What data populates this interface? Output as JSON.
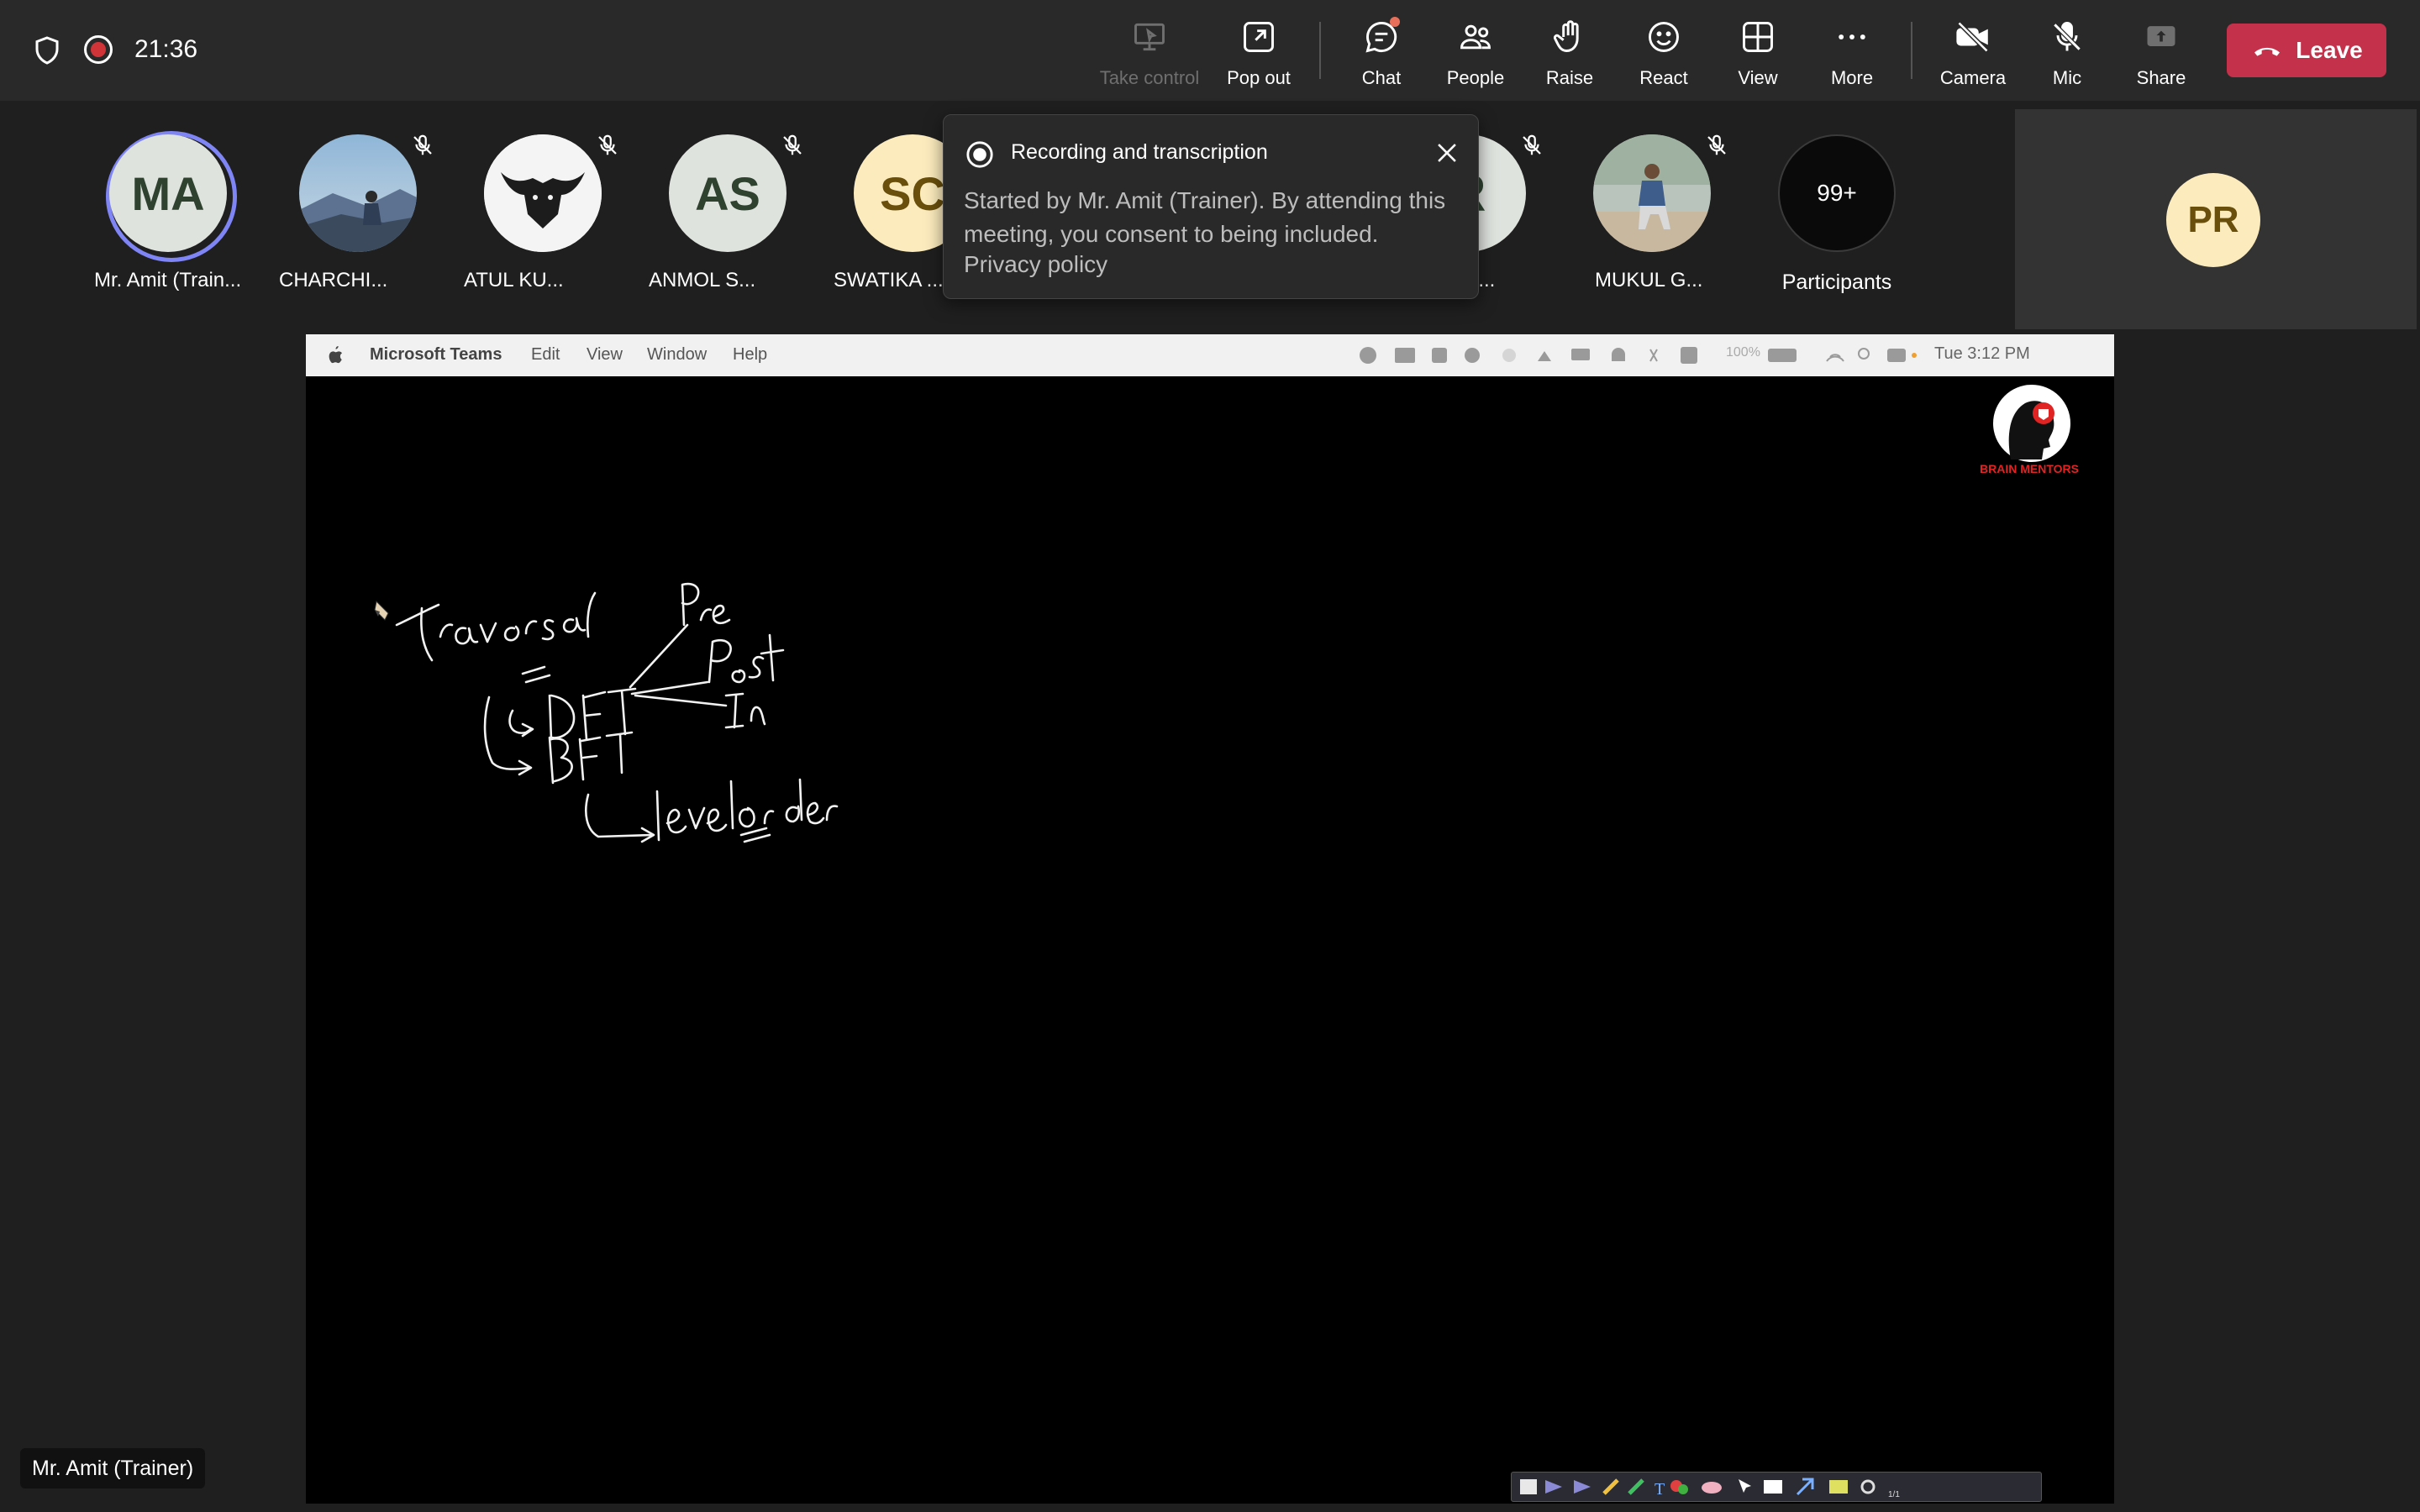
{
  "meeting": {
    "elapsed": "21:36"
  },
  "toolbar": {
    "take_control": "Take control",
    "pop_out": "Pop out",
    "chat": "Chat",
    "people": "People",
    "raise": "Raise",
    "react": "React",
    "view": "View",
    "more": "More",
    "camera": "Camera",
    "mic": "Mic",
    "share": "Share",
    "leave": "Leave",
    "leave_color": "#c4314b"
  },
  "participants": [
    {
      "initials": "MA",
      "name": "Mr. Amit (Train...",
      "muted": false,
      "active": true
    },
    {
      "initials": "",
      "name": "CHARCHI...",
      "muted": true,
      "photo": "person-mountain-photo"
    },
    {
      "initials": "",
      "name": "ATUL KU...",
      "muted": true,
      "photo": "bull-logo-photo"
    },
    {
      "initials": "AS",
      "name": "ANMOL S...",
      "muted": true
    },
    {
      "initials": "SC",
      "name": "SWATIKA ...",
      "muted": false
    },
    {
      "initials": "R",
      "name": "R...",
      "muted": true
    },
    {
      "initials": "",
      "name": "MUKUL G...",
      "muted": true,
      "photo": "person-sitting-photo"
    }
  ],
  "participants_count": {
    "value": "99+",
    "label": "Participants"
  },
  "self_view": {
    "initials": "PR"
  },
  "recording_popup": {
    "title": "Recording and transcription",
    "body": "Started by Mr. Amit (Trainer). By attending this meeting, you consent to being included.",
    "link": "Privacy policy"
  },
  "shared_screen": {
    "menubar": {
      "app": "Microsoft Teams",
      "menus": [
        "Edit",
        "View",
        "Window",
        "Help"
      ],
      "battery": "100%",
      "clock": "Tue 3:12 PM"
    },
    "logo_text": "BRAIN MENTORS"
  },
  "presenter_label": "Mr. Amit (Trainer)"
}
